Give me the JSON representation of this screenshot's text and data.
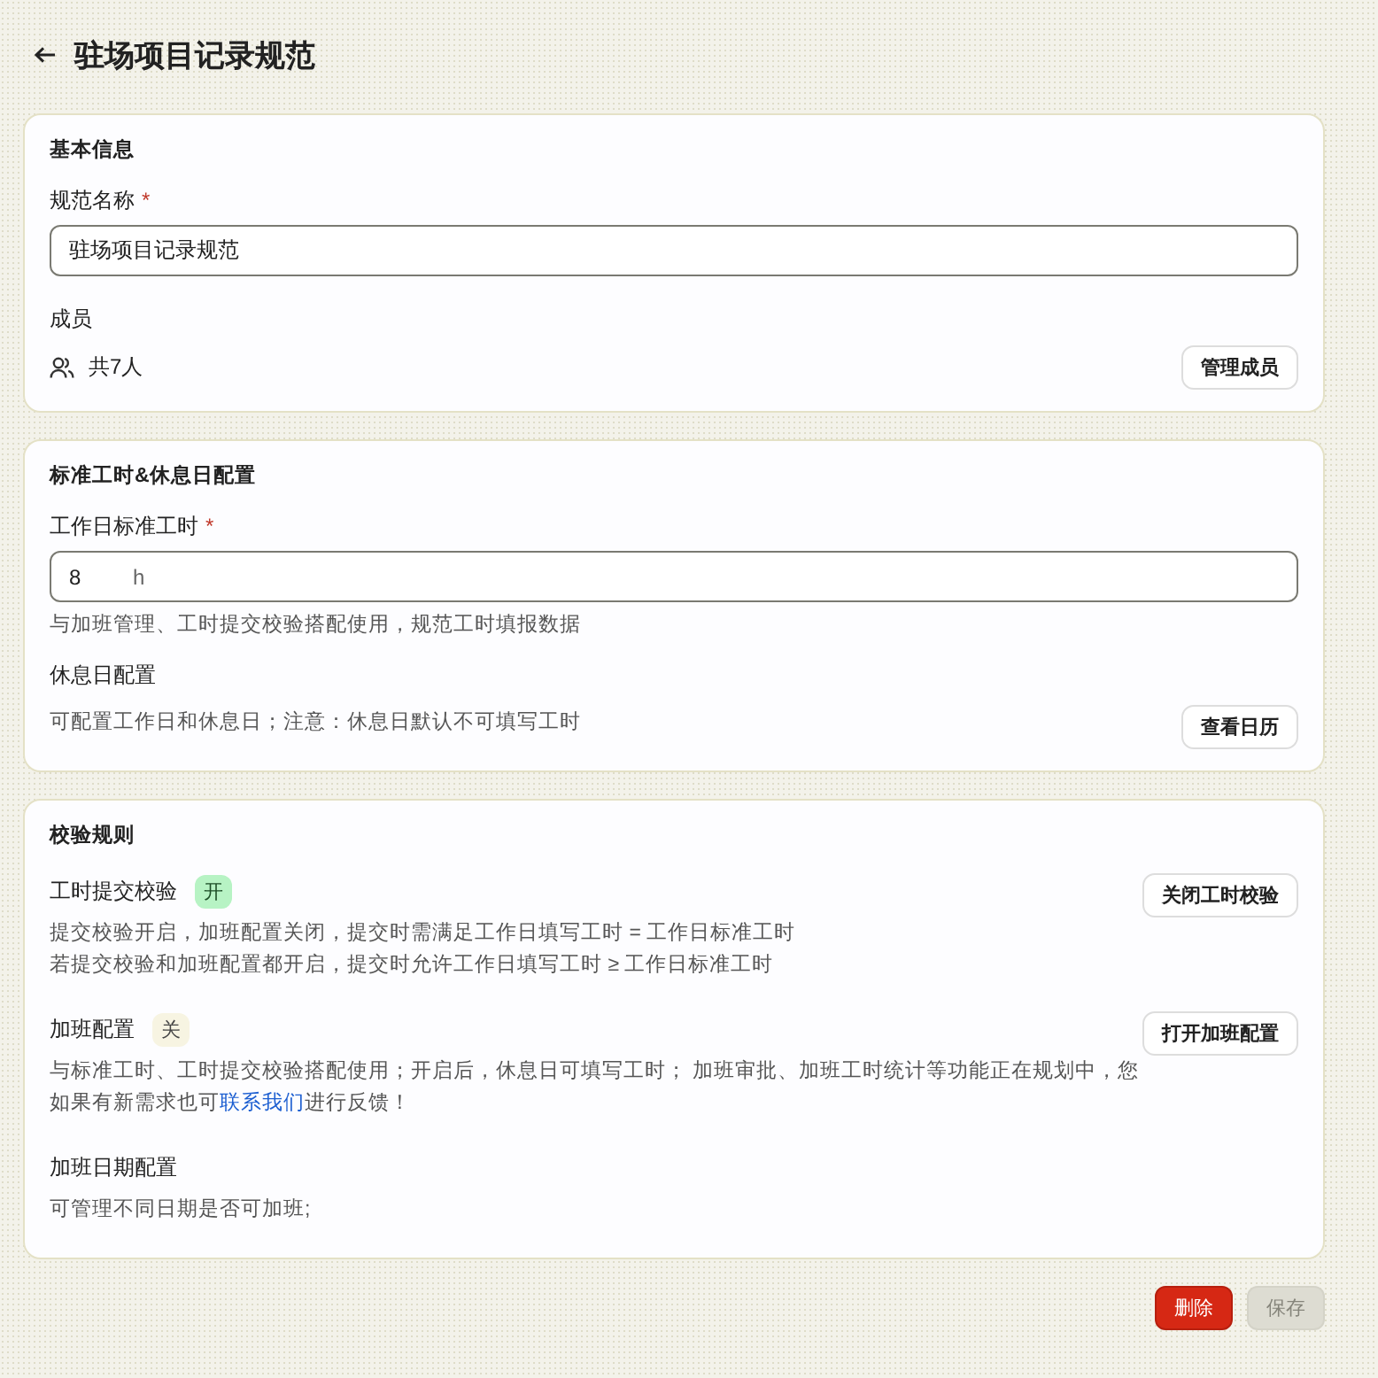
{
  "header": {
    "title": "驻场项目记录规范"
  },
  "basic_info": {
    "title": "基本信息",
    "name_field": {
      "label": "规范名称",
      "required_mark": "*",
      "value": "驻场项目记录规范"
    },
    "members": {
      "label": "成员",
      "count": "共7人",
      "button": "管理成员"
    }
  },
  "hours": {
    "title": "标准工时&休息日配置",
    "hours_field": {
      "label": "工作日标准工时",
      "required_mark": "*",
      "value": "8",
      "unit": "h",
      "hint": "与加班管理、工时提交校验搭配使用，规范工时填报数据"
    },
    "rest_day": {
      "label": "休息日配置",
      "description": "可配置工作日和休息日；注意：休息日默认不可填写工时",
      "button": "查看日历"
    }
  },
  "rules": {
    "title": "校验规则",
    "items": [
      {
        "label": "工时提交校验",
        "status": "开",
        "on": true,
        "paragraphs": [
          {
            "text": "提交校验开启，加班配置关闭，提交时需满足工作日填写工时 = 工作日标准工时"
          },
          {
            "text": "若提交校验和加班配置都开启，提交时允许工作日填写工时 ≥ 工作日标准工时"
          }
        ],
        "button": "关闭工时校验"
      },
      {
        "label": "加班配置",
        "status": "关",
        "on": false,
        "paragraphs": [
          {
            "text": "与标准工时、工时提交校验搭配使用；开启后，休息日可填写工时； 加班审批、加班工时统计等功能正在规划中，您如果有新需求也可",
            "link": "联系我们",
            "text_after": "进行反馈！"
          }
        ],
        "button": "打开加班配置"
      },
      {
        "label": "加班日期配置",
        "paragraphs": [
          {
            "text": "可管理不同日期是否可加班;"
          }
        ]
      }
    ]
  },
  "footer": {
    "buttons": [
      {
        "label": "删除",
        "kind": "danger",
        "disabled": false
      },
      {
        "label": "保存",
        "kind": "primary",
        "disabled": true
      }
    ]
  }
}
